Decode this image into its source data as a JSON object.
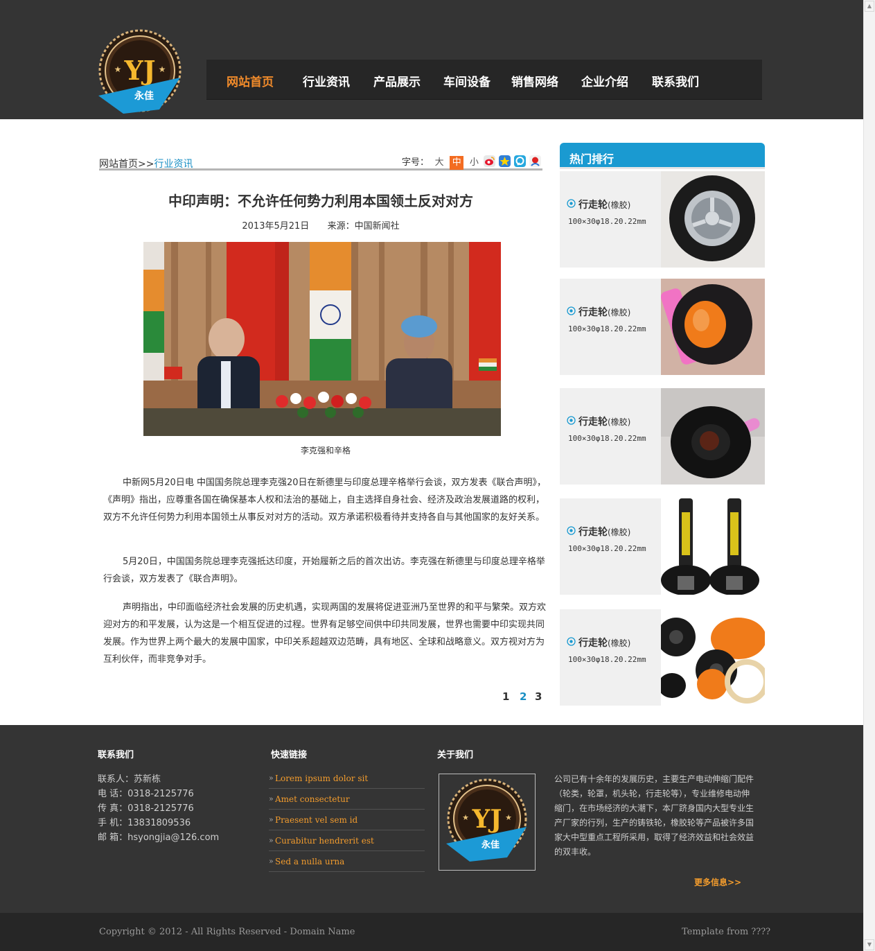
{
  "header": {
    "logo_text": "YJ",
    "logo_subtext": "永佳",
    "nav": [
      {
        "label": "网站首页",
        "active": true
      },
      {
        "label": "行业资讯",
        "active": false
      },
      {
        "label": "产品展示",
        "active": false
      },
      {
        "label": "车间设备",
        "active": false
      },
      {
        "label": "销售网络",
        "active": false
      },
      {
        "label": "企业介绍",
        "active": false
      },
      {
        "label": "联系我们",
        "active": false
      }
    ]
  },
  "breadcrumb": {
    "home": "网站首页>>",
    "current": "行业资讯"
  },
  "font_size": {
    "label": "字号：",
    "options": [
      "大",
      "中",
      "小"
    ],
    "selected": "中"
  },
  "share_icons": [
    "weibo-icon",
    "qzone-icon",
    "tqq-icon",
    "renren-icon"
  ],
  "article": {
    "title": "中印声明：不允许任何势力利用本国领土反对对方",
    "date": "2013年5月21日",
    "source": "来源：中国新闻社",
    "caption": "李克强和辛格",
    "paragraphs": [
      "中新网5月20日电  中国国务院总理李克强20日在新德里与印度总理辛格举行会谈，双方发表《联合声明》，《声明》指出，应尊重各国在确保基本人权和法治的基础上，自主选择自身社会、经济及政治发展道路的权利，双方不允许任何势力利用本国领土从事反对对方的活动。双方承诺积极看待并支持各自与其他国家的友好关系。",
      "5月20日，中国国务院总理李克强抵达印度，开始履新之后的首次出访。李克强在新德里与印度总理辛格举行会谈，双方发表了《联合声明》。",
      "声明指出，中印面临经济社会发展的历史机遇，实现两国的发展将促进亚洲乃至世界的和平与繁荣。双方欢迎对方的和平发展，认为这是一个相互促进的过程。世界有足够空间供中印共同发展，世界也需要中印实现共同发展。作为世界上两个最大的发展中国家，中印关系超越双边范畴，具有地区、全球和战略意义。双方视对方为互利伙伴，而非竞争对手。"
    ],
    "pages": [
      "1",
      "2",
      "3"
    ],
    "current_page": "2"
  },
  "sidebar": {
    "title": "热门排行",
    "items": [
      {
        "name": "行走轮",
        "material": "(橡胶)",
        "spec": "100×30φ18.20.22mm"
      },
      {
        "name": "行走轮",
        "material": "(橡胶)",
        "spec": "100×30φ18.20.22mm"
      },
      {
        "name": "行走轮",
        "material": "(橡胶)",
        "spec": "100×30φ18.20.22mm"
      },
      {
        "name": "行走轮",
        "material": "(橡胶)",
        "spec": "100×30φ18.20.22mm"
      },
      {
        "name": "行走轮",
        "material": "(橡胶)",
        "spec": "100×30φ18.20.22mm"
      }
    ]
  },
  "footer": {
    "contact": {
      "title": "联系我们",
      "lines": [
        "联系人：苏新栋",
        "电 话：0318-2125776",
        "传 真：0318-2125776",
        "手 机：13831809536",
        "邮 箱：hsyongjia@126.com"
      ]
    },
    "links": {
      "title": "快速链接",
      "items": [
        "Lorem ipsum dolor sit",
        "Amet consectetur",
        "Praesent vel sem id",
        "Curabitur hendrerit est",
        "Sed a nulla urna"
      ]
    },
    "about": {
      "title": "关于我们",
      "text": "公司已有十余年的发展历史，主要生产电动伸缩门配件（轮类，轮罩，机头轮，行走轮等），专业维修电动伸缩门，在市场经济的大潮下，本厂跻身国内大型专业生产厂家的行列，生产的铸铁轮，橡胶轮等产品被许多国家大中型重点工程所采用，取得了经济效益和社会效益的双丰收。",
      "more": "更多信息>>"
    },
    "copyright": "Copyright © 2012 - All Rights Reserved - Domain Name",
    "template": "Template from ????"
  },
  "colors": {
    "accent_orange": "#f18b2b",
    "accent_blue": "#1a9ad1",
    "dark_bg": "#343434"
  }
}
